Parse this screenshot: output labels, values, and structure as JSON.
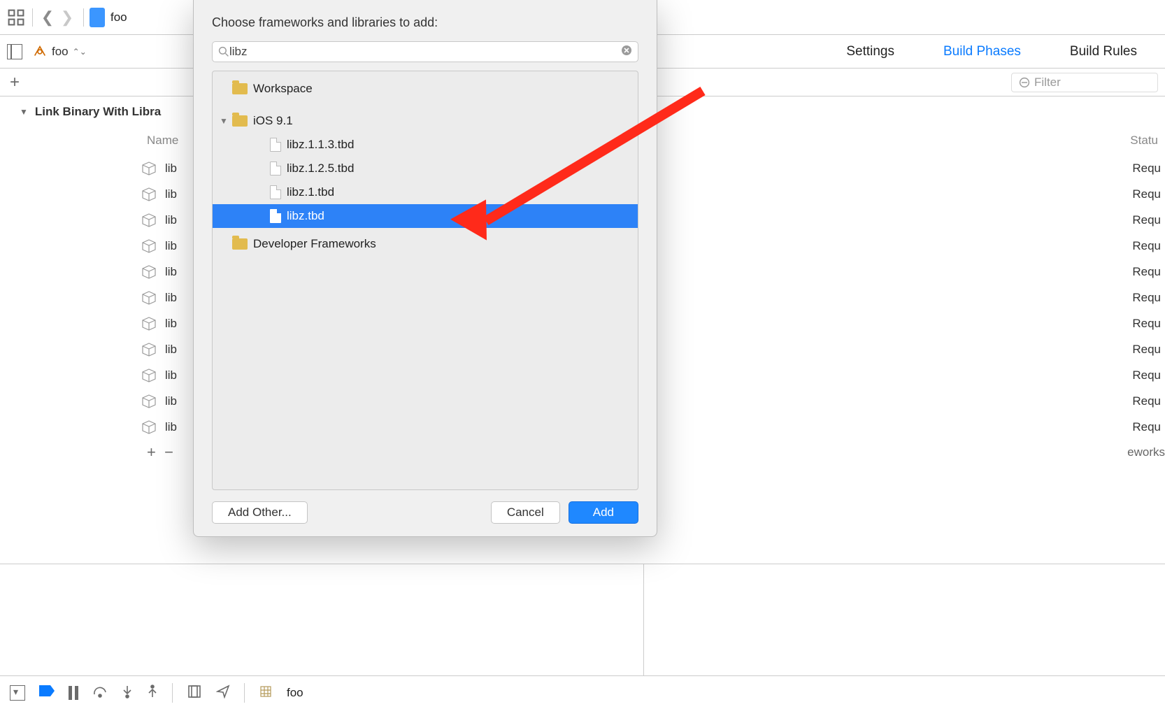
{
  "toolbar": {
    "crumb_label": "foo"
  },
  "target_selector": {
    "name": "foo"
  },
  "tabs": {
    "settings": "Settings",
    "build_phases": "Build Phases",
    "build_rules": "Build Rules"
  },
  "filter": {
    "placeholder": "Filter"
  },
  "phase": {
    "link_title": "Link Binary With Libra"
  },
  "columns": {
    "name": "Name",
    "status": "Statu"
  },
  "lib_rows": [
    {
      "label": "lib",
      "status": "Requ"
    },
    {
      "label": "lib",
      "status": "Requ"
    },
    {
      "label": "lib",
      "status": "Requ"
    },
    {
      "label": "lib",
      "status": "Requ"
    },
    {
      "label": "lib",
      "status": "Requ"
    },
    {
      "label": "lib",
      "status": "Requ"
    },
    {
      "label": "lib",
      "status": "Requ"
    },
    {
      "label": "lib",
      "status": "Requ"
    },
    {
      "label": "lib",
      "status": "Requ"
    },
    {
      "label": "lib",
      "status": "Requ"
    },
    {
      "label": "lib",
      "status": "Requ"
    }
  ],
  "drag_help": "eworks",
  "debug": {
    "process": "foo"
  },
  "sheet": {
    "title": "Choose frameworks and libraries to add:",
    "search": "libz",
    "tree": {
      "workspace": "Workspace",
      "ios": "iOS 9.1",
      "items": [
        "libz.1.1.3.tbd",
        "libz.1.2.5.tbd",
        "libz.1.tbd",
        "libz.tbd"
      ],
      "devfw": "Developer Frameworks"
    },
    "buttons": {
      "add_other": "Add Other...",
      "cancel": "Cancel",
      "add": "Add"
    }
  }
}
